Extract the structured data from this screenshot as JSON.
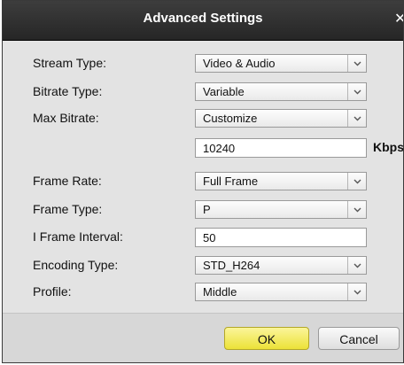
{
  "dialog": {
    "title": "Advanced Settings",
    "close_glyph": "✕"
  },
  "fields": {
    "stream_type": {
      "label": "Stream Type:",
      "value": "Video & Audio"
    },
    "bitrate_type": {
      "label": "Bitrate Type:",
      "value": "Variable"
    },
    "max_bitrate": {
      "label": "Max Bitrate:",
      "value": "Customize",
      "custom_value": "10240",
      "unit": "Kbps"
    },
    "frame_rate": {
      "label": "Frame Rate:",
      "value": "Full Frame"
    },
    "frame_type": {
      "label": "Frame Type:",
      "value": "P"
    },
    "i_frame_interval": {
      "label": "I Frame Interval:",
      "value": "50"
    },
    "encoding_type": {
      "label": "Encoding Type:",
      "value": "STD_H264"
    },
    "profile": {
      "label": "Profile:",
      "value": "Middle"
    }
  },
  "buttons": {
    "ok": "OK",
    "cancel": "Cancel"
  },
  "colors": {
    "titlebar": "#2e2e2e",
    "ok_button": "#f2e94e"
  }
}
